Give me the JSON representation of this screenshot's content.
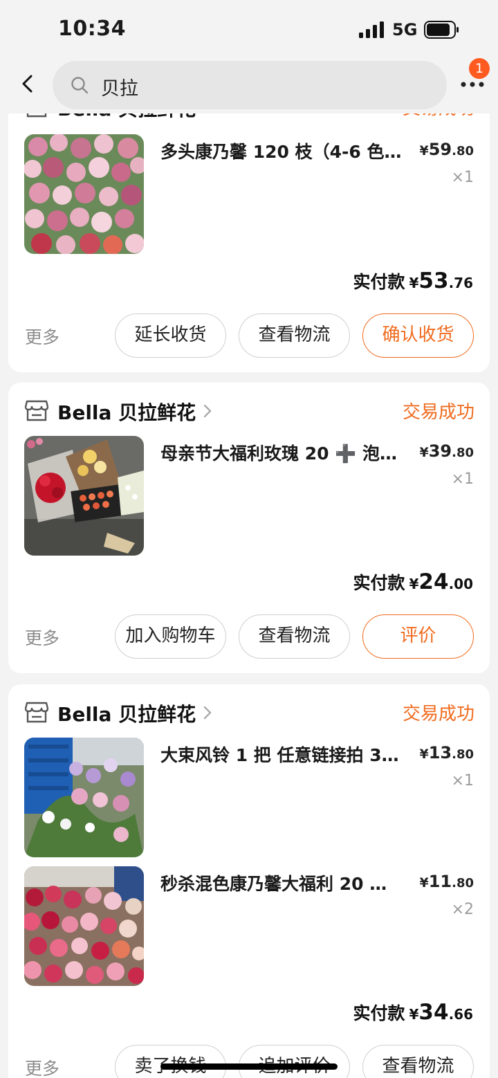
{
  "status_bar": {
    "time": "10:34",
    "network": "5G"
  },
  "nav": {
    "search_query": "贝拉",
    "badge_count": "1"
  },
  "orders": [
    {
      "shop": "Bella 贝拉鲜花",
      "status": "交易成功",
      "items": [
        {
          "title": "多头康乃馨 120 枝（4-6 色…",
          "price_yen": "¥",
          "price_int": "59",
          "price_dec": ".80",
          "qty": "×1"
        }
      ],
      "paid_label": "实付款",
      "paid_yen": "¥",
      "paid_int": "53",
      "paid_dec": ".76",
      "more": "更多",
      "buttons": [
        "延长收货",
        "查看物流",
        "确认收货"
      ]
    },
    {
      "shop": "Bella 贝拉鲜花",
      "status": "交易成功",
      "items": [
        {
          "title": "母亲节大福利玫瑰 20 ➕ 泡…",
          "price_yen": "¥",
          "price_int": "39",
          "price_dec": ".80",
          "qty": "×1"
        }
      ],
      "paid_label": "实付款",
      "paid_yen": "¥",
      "paid_int": "24",
      "paid_dec": ".00",
      "more": "更多",
      "buttons": [
        "加入购物车",
        "查看物流",
        "评价"
      ]
    },
    {
      "shop": "Bella 贝拉鲜花",
      "status": "交易成功",
      "items": [
        {
          "title": "大束风铃 1 把 任意链接拍 3…",
          "price_yen": "¥",
          "price_int": "13",
          "price_dec": ".80",
          "qty": "×1"
        },
        {
          "title": "秒杀混色康乃馨大福利 20 枝 …",
          "price_yen": "¥",
          "price_int": "11",
          "price_dec": ".80",
          "qty": "×2"
        }
      ],
      "paid_label": "实付款",
      "paid_yen": "¥",
      "paid_int": "34",
      "paid_dec": ".66",
      "more": "更多",
      "buttons": [
        "卖了换钱",
        "追加评价",
        "查看物流"
      ]
    }
  ],
  "icons": {
    "back": "chevron-left-icon",
    "search": "search-icon",
    "more": "more-dots-icon",
    "shop": "store-icon",
    "chevron": "chevron-right-icon"
  },
  "colors": {
    "accent": "#f06b1e",
    "badge": "#ff5a1f"
  }
}
